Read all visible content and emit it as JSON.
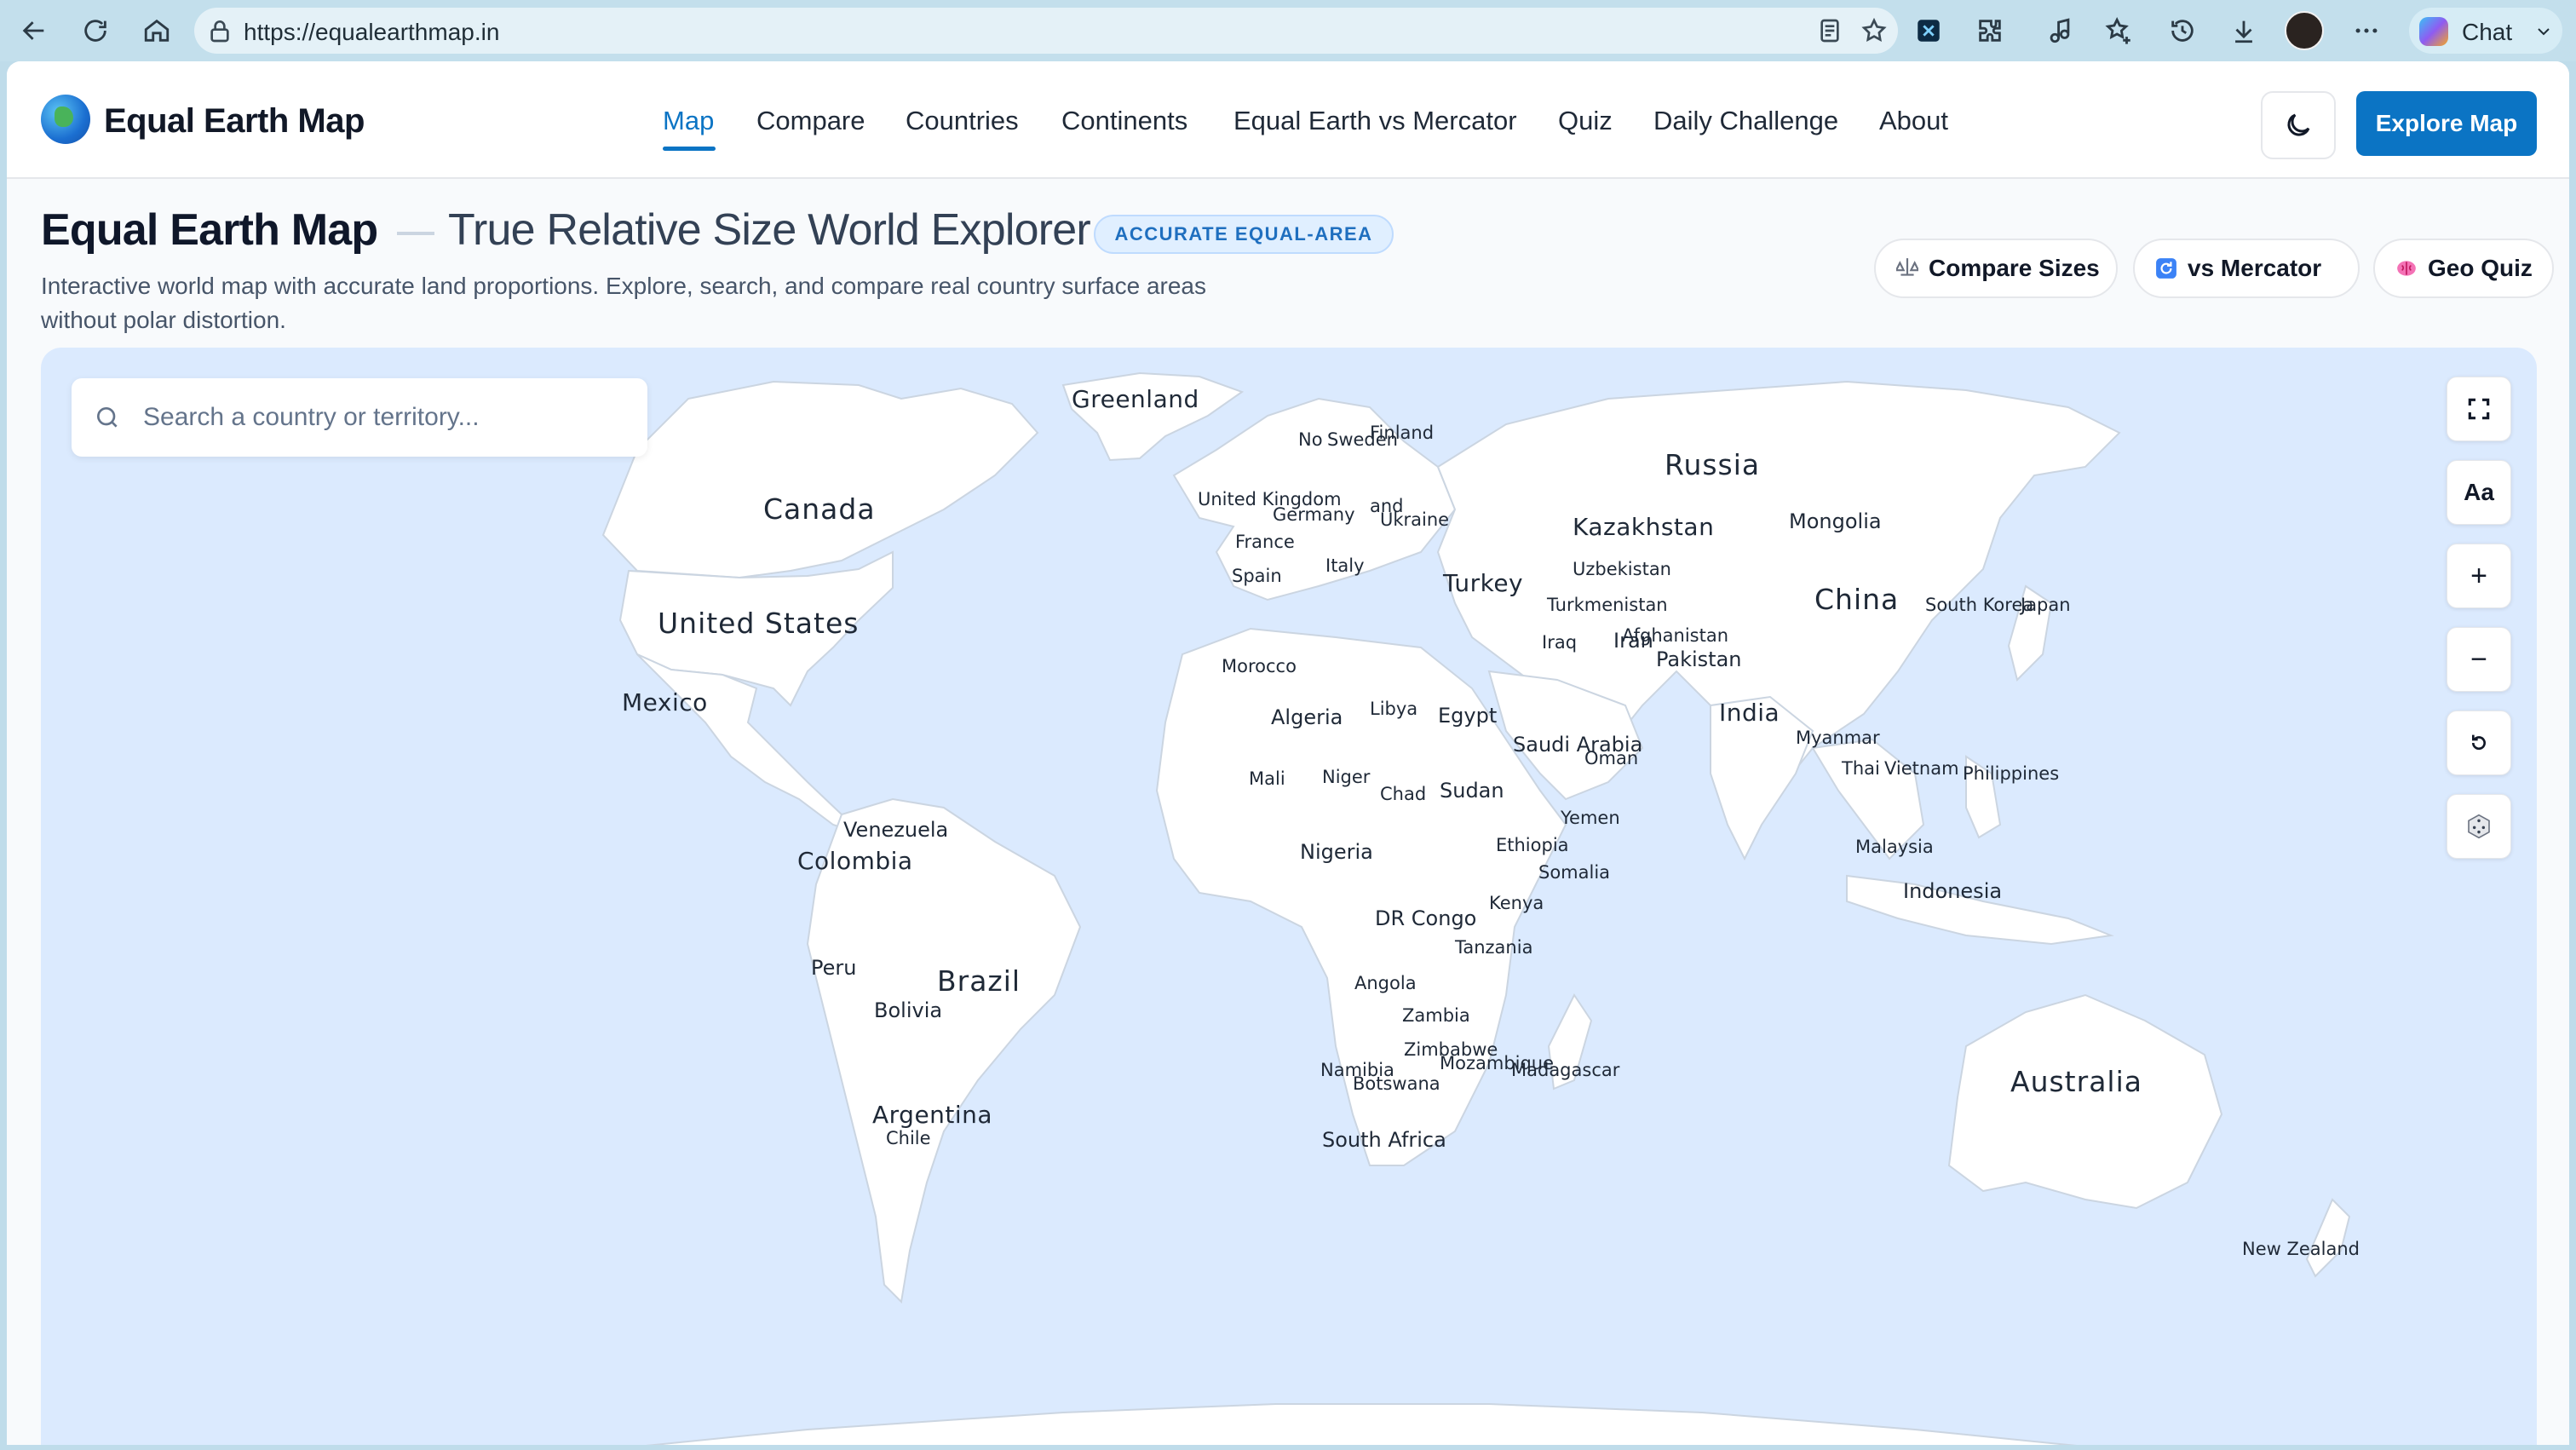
{
  "browser": {
    "url": "https://equalearthmap.in",
    "chat_label": "Chat",
    "icons": [
      "back-arrow-icon",
      "reload-icon",
      "home-icon",
      "lock-icon",
      "reader-icon",
      "star-icon",
      "extension-icon",
      "puzzle-icon",
      "media-icon",
      "favorites-icon",
      "history-icon",
      "download-icon",
      "avatar",
      "more-icon",
      "copilot-icon",
      "chevron-down-icon"
    ]
  },
  "header": {
    "brand": "Equal Earth Map",
    "nav": [
      {
        "label": "Map",
        "active": true
      },
      {
        "label": "Compare"
      },
      {
        "label": "Countries"
      },
      {
        "label": "Continents"
      },
      {
        "label": "Equal Earth vs Mercator"
      },
      {
        "label": "Quiz"
      },
      {
        "label": "Daily Challenge"
      },
      {
        "label": "About"
      }
    ],
    "explore_label": "Explore Map",
    "accent": "#0b74c4"
  },
  "hero": {
    "title": "Equal Earth Map",
    "subtitle": "True Relative Size World Explorer",
    "badge": "ACCURATE EQUAL-AREA",
    "description": "Interactive world map with accurate land proportions. Explore, search, and compare real country surface areas without polar distortion.",
    "actions": [
      {
        "label": "Compare Sizes",
        "icon": "scale-icon"
      },
      {
        "label": "vs Mercator",
        "icon": "refresh-icon"
      },
      {
        "label": "Geo Quiz",
        "icon": "brain-icon"
      }
    ]
  },
  "map": {
    "search_placeholder": "Search a country or territory...",
    "controls": [
      {
        "label": "",
        "name": "fullscreen-button"
      },
      {
        "label": "Aa",
        "name": "label-size-button"
      },
      {
        "label": "+",
        "name": "zoom-in-button"
      },
      {
        "label": "−",
        "name": "zoom-out-button"
      },
      {
        "label": "",
        "name": "reset-view-button"
      },
      {
        "label": "",
        "name": "random-country-button"
      }
    ],
    "labels": {
      "greenland": "Greenland",
      "canada": "Canada",
      "united_states": "United States",
      "mexico": "Mexico",
      "venezuela": "Venezuela",
      "colombia": "Colombia",
      "peru": "Peru",
      "brazil": "Brazil",
      "bolivia": "Bolivia",
      "argentina": "Argentina",
      "chile": "Chile",
      "norway": "No",
      "sweden": "Sweden",
      "finland": "Finland",
      "united_kingdom": "United Kingdom",
      "germany": "Germany",
      "poland": "and",
      "ukraine": "Ukraine",
      "france": "France",
      "italy": "Italy",
      "spain": "Spain",
      "turkey": "Turkey",
      "russia": "Russia",
      "kazakhstan": "Kazakhstan",
      "mongolia": "Mongolia",
      "uzbekistan": "Uzbekistan",
      "turkmenistan": "Turkmenistan",
      "afghanistan": "Afghanistan",
      "iraq": "Iraq",
      "iran": "Iran",
      "pakistan": "Pakistan",
      "china": "China",
      "south_korea": "South Korea",
      "japan": "Japan",
      "india": "India",
      "myanmar": "Myanmar",
      "thailand": "Thai",
      "vietnam": "Vietnam",
      "philippines": "Philippines",
      "malaysia": "Malaysia",
      "indonesia": "Indonesia",
      "australia": "Australia",
      "new_zealand": "New Zealand",
      "morocco": "Morocco",
      "algeria": "Algeria",
      "libya": "Libya",
      "egypt": "Egypt",
      "saudi_arabia": "Saudi Arabia",
      "oman": "Oman",
      "yemen": "Yemen",
      "mali": "Mali",
      "niger": "Niger",
      "chad": "Chad",
      "sudan": "Sudan",
      "nigeria": "Nigeria",
      "ethiopia": "Ethiopia",
      "somalia": "Somalia",
      "kenya": "Kenya",
      "dr_congo": "DR Congo",
      "tanzania": "Tanzania",
      "angola": "Angola",
      "zambia": "Zambia",
      "zimbabwe": "Zimbabwe",
      "mozambique": "Mozambique",
      "namibia": "Namibia",
      "botswana": "Botswana",
      "madagascar": "Madagascar",
      "south_africa": "South Africa"
    }
  }
}
